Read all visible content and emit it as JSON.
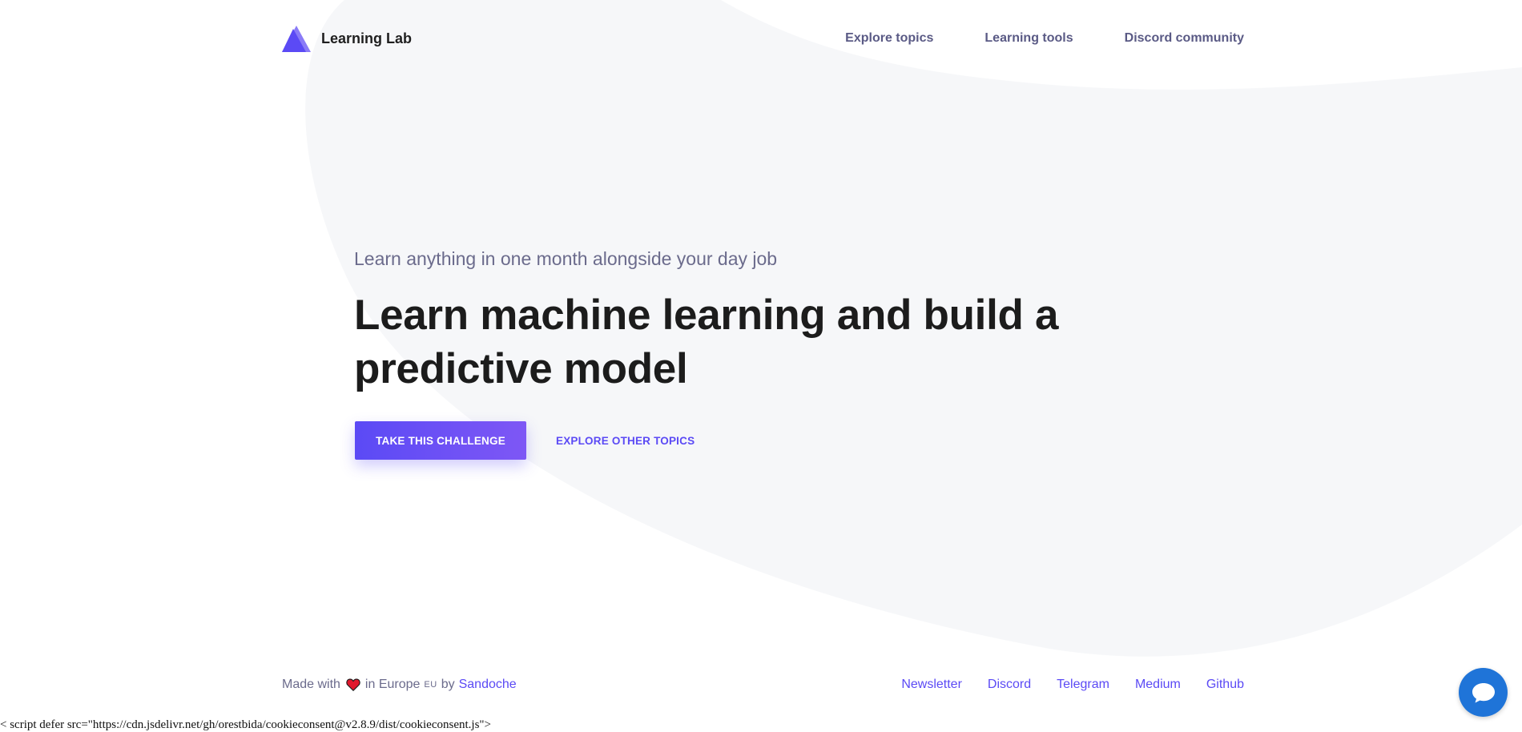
{
  "header": {
    "logo_text": "Learning Lab",
    "nav": [
      {
        "label": "Explore topics"
      },
      {
        "label": "Learning tools"
      },
      {
        "label": "Discord community"
      }
    ]
  },
  "hero": {
    "subtitle": "Learn anything in one month alongside your day job",
    "title": "Learn machine learning and build a predictive model",
    "primary_button": "TAKE THIS CHALLENGE",
    "secondary_link": "EXPLORE OTHER TOPICS"
  },
  "footer": {
    "made_with": "Made with",
    "in_europe": "in Europe",
    "eu_badge": "EU",
    "by": "by",
    "author": "Sandoche",
    "links": [
      {
        "label": "Newsletter"
      },
      {
        "label": "Discord"
      },
      {
        "label": "Telegram"
      },
      {
        "label": "Medium"
      },
      {
        "label": "Github"
      }
    ]
  },
  "raw_script_text": "< script defer src=\"https://cdn.jsdelivr.net/gh/orestbida/cookieconsent@v2.8.9/dist/cookieconsent.js\">",
  "colors": {
    "accent": "#5b4af5",
    "nav_text": "#5a5a85",
    "blob": "#f6f7f9",
    "chat": "#1f74d8"
  },
  "icons": {
    "logo": "triangle-logo-icon",
    "heart": "heart-icon",
    "chat": "chat-bubble-icon"
  }
}
